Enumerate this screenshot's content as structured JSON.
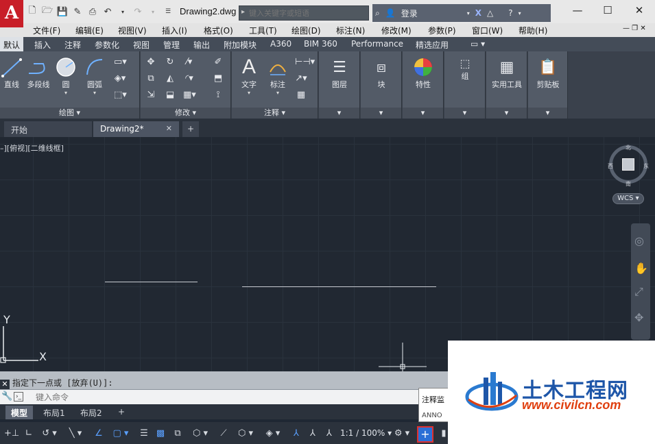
{
  "app": {
    "logo_letter": "A",
    "doc_title": "Drawing2.dwg",
    "search_placeholder": "键入关键字或短语",
    "login": "登录"
  },
  "menu": [
    "文件(F)",
    "编辑(E)",
    "视图(V)",
    "插入(I)",
    "格式(O)",
    "工具(T)",
    "绘图(D)",
    "标注(N)",
    "修改(M)",
    "参数(P)",
    "窗口(W)",
    "帮助(H)"
  ],
  "ribbon_tabs": [
    "默认",
    "插入",
    "注释",
    "参数化",
    "视图",
    "管理",
    "输出",
    "附加模块",
    "A360",
    "BIM 360",
    "Performance",
    "精选应用"
  ],
  "ribbon": {
    "draw_tools": [
      "直线",
      "多段线",
      "圆",
      "圆弧"
    ],
    "draw_panel": "绘图 ▾",
    "modify_panel": "修改 ▾",
    "annot_tools": [
      "文字",
      "标注"
    ],
    "annot_panel": "注释 ▾",
    "layer": "图层",
    "block": "块",
    "props": "特性",
    "group": "组",
    "utilities": "实用工具",
    "clipboard": "剪贴板"
  },
  "doc_tabs": {
    "start": "开始",
    "drawing": "Drawing2*",
    "close": "✕",
    "add": "+"
  },
  "viewport": {
    "label": "–][俯视][二维线框]",
    "compass": {
      "n": "北",
      "s": "南",
      "e": "东",
      "w": "西"
    },
    "wcs": "WCS ▾",
    "ucs_y": "Y",
    "ucs_x": "X"
  },
  "command": {
    "history": "指定下一点或 [放弃(U)]:",
    "input_placeholder": "键入命令"
  },
  "layout_tabs": [
    "模型",
    "布局1",
    "布局2"
  ],
  "layout_add": "+",
  "status": {
    "scale": "1:1 / 100% ▾"
  },
  "tooltip": {
    "title": "注释监",
    "sub": "ANNO"
  },
  "watermark": {
    "title": "土木工程网",
    "url": "www.civilcn.com"
  }
}
